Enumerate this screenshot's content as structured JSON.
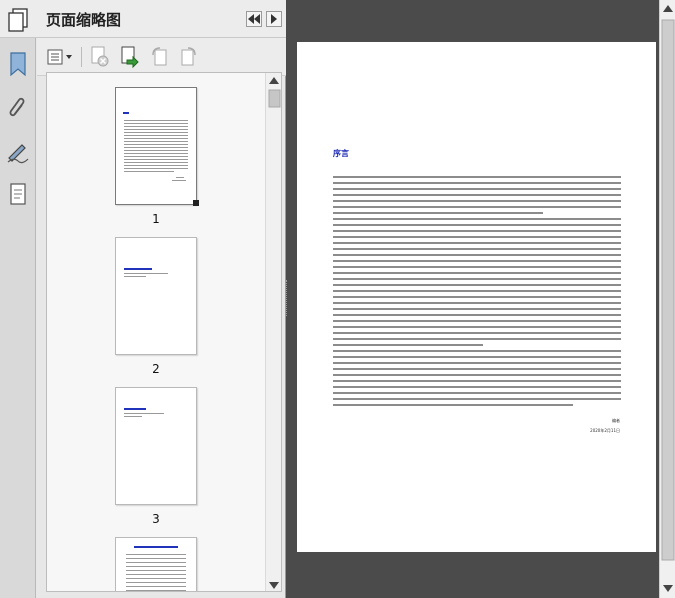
{
  "panel": {
    "title": "页面缩略图"
  },
  "thumbnails": [
    {
      "number": "1"
    },
    {
      "number": "2"
    },
    {
      "number": "3"
    }
  ],
  "document": {
    "page_heading": "序言",
    "signature_name": "编者",
    "signature_date": "2020年2月11日"
  },
  "colors": {
    "heading_accent": "#1a27b5",
    "thumb_title": "#2233bb"
  }
}
